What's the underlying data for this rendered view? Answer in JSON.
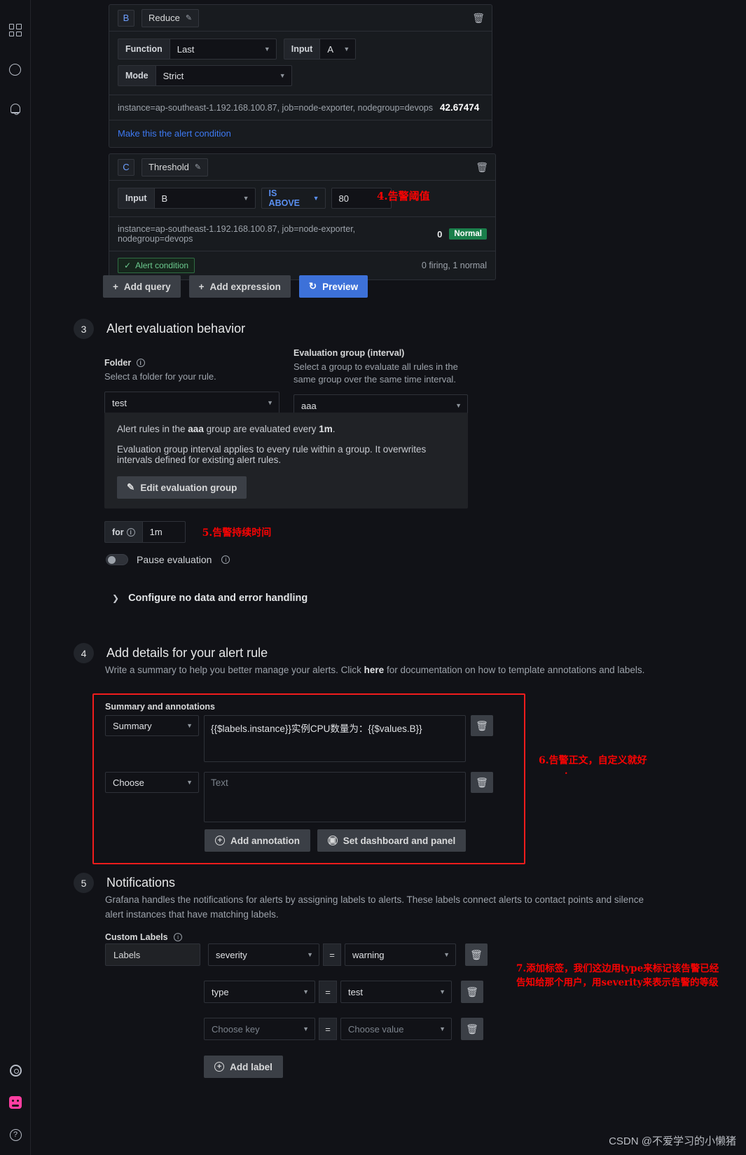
{
  "rail": {
    "items": [
      {
        "name": "dashboards-icon",
        "label": "Dashboards"
      },
      {
        "name": "explore-icon",
        "label": "Explore"
      },
      {
        "name": "alerting-bell-icon",
        "label": "Alerting"
      }
    ],
    "bottom": [
      {
        "name": "gear-icon",
        "label": "Configuration"
      },
      {
        "name": "plugin-icon",
        "label": "Plugin"
      },
      {
        "name": "help-icon",
        "label": "Help"
      }
    ]
  },
  "expressions": {
    "reduce": {
      "ref": "B",
      "type_name": "Reduce",
      "function_label": "Function",
      "function_value": "Last",
      "input_label": "Input",
      "input_value": "A",
      "mode_label": "Mode",
      "mode_value": "Strict",
      "result_series": "instance=ap-southeast-1.192.168.100.87, job=node-exporter, nodegroup=devops",
      "result_value": "42.67474",
      "make_condition_link": "Make this the alert condition"
    },
    "threshold": {
      "ref": "C",
      "type_name": "Threshold",
      "input_label": "Input",
      "input_value": "B",
      "operator": "IS ABOVE",
      "threshold_value": "80",
      "result_series": "instance=ap-southeast-1.192.168.100.87, job=node-exporter, nodegroup=devops",
      "result_value": "0",
      "state_badge": "Normal",
      "alert_condition_badge": "Alert condition",
      "firing_status": "0 firing, 1 normal"
    },
    "toolbar": {
      "add_query": "Add query",
      "add_expression": "Add expression",
      "preview": "Preview"
    }
  },
  "step3": {
    "number": "3",
    "title": "Alert evaluation behavior",
    "folder_label": "Folder",
    "folder_desc": "Select a folder for your rule.",
    "folder_value": "test",
    "group_label": "Evaluation group (interval)",
    "group_desc": "Select a group to evaluate all rules in the same group over the same time interval.",
    "group_value": "aaa",
    "info_line1_pre": "Alert rules in the ",
    "info_line1_group": "aaa",
    "info_line1_mid": " group are evaluated every ",
    "info_line1_interval": "1m",
    "info_line1_post": ".",
    "info_line2": "Evaluation group interval applies to every rule within a group. It overwrites intervals defined for existing alert rules.",
    "edit_group_button": "Edit evaluation group",
    "for_label": "for",
    "for_value": "1m",
    "pause_label": "Pause evaluation",
    "configure_nodata": "Configure no data and error handling"
  },
  "step4": {
    "number": "4",
    "title": "Add details for your alert rule",
    "desc_pre": "Write a summary to help you better manage your alerts. Click ",
    "desc_link": "here",
    "desc_post": " for documentation on how to template annotations and labels.",
    "section_label": "Summary and annotations",
    "summary_select": "Summary",
    "summary_value": "{{$labels.instance}}实例CPU数量为：{{$values.B}}",
    "choose_select": "Choose",
    "text_placeholder": "Text",
    "add_annotation_button": "Add annotation",
    "set_dashboard_button": "Set dashboard and panel"
  },
  "step5": {
    "number": "5",
    "title": "Notifications",
    "desc": "Grafana handles the notifications for alerts by assigning labels to alerts. These labels connect alerts to contact points and silence alert instances that have matching labels.",
    "custom_labels_label": "Custom Labels",
    "labels_static": "Labels",
    "equals": "=",
    "rows": [
      {
        "key": "severity",
        "value": "warning"
      },
      {
        "key": "type",
        "value": "test"
      },
      {
        "key": "Choose key",
        "value": "Choose value",
        "placeholder": true
      }
    ],
    "add_label_button": "Add label"
  },
  "annotations": {
    "a4": "4.告警阈值",
    "a5": "5.告警持续时间",
    "a6": "6.告警正文，自定义就好",
    "a7_line1": "7.添加标签，我们这边用type来标记该告警已经",
    "a7_line2": "告知给那个用户，用severity来表示告警的等级"
  },
  "watermark": "CSDN @不爱学习的小懒猪",
  "colors": {
    "accent_blue": "#3d71d9",
    "link_blue": "#3d79f2",
    "normal_green": "#1a7f4b",
    "annotation_red": "#fb0303",
    "panel_bg": "#181b1f",
    "page_bg": "#111217"
  }
}
